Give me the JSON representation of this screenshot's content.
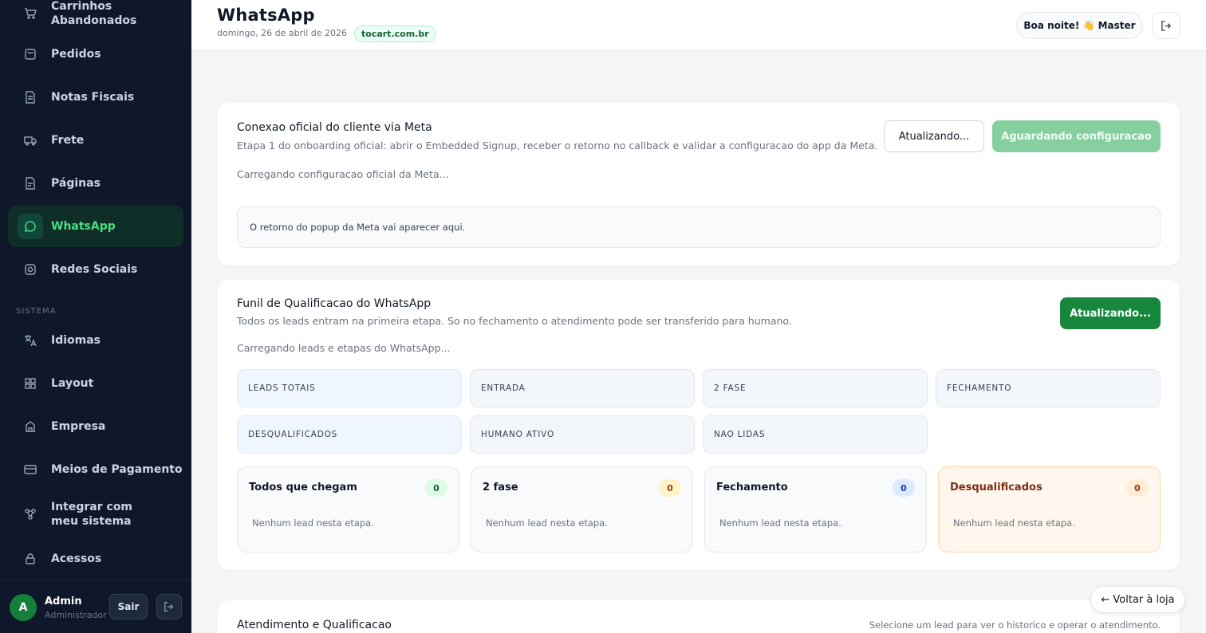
{
  "sidebar": {
    "items": [
      {
        "label": "Carrinhos Abandonados",
        "icon": "cart-icon"
      },
      {
        "label": "Pedidos",
        "icon": "bag-icon"
      },
      {
        "label": "Notas Fiscais",
        "icon": "document-icon"
      },
      {
        "label": "Frete",
        "icon": "truck-icon"
      },
      {
        "label": "Páginas",
        "icon": "page-icon"
      },
      {
        "label": "WhatsApp",
        "icon": "chat-icon"
      },
      {
        "label": "Redes Sociais",
        "icon": "instagram-icon"
      },
      {
        "label": "Idiomas",
        "icon": "translate-icon"
      },
      {
        "label": "Layout",
        "icon": "layout-icon"
      },
      {
        "label": "Empresa",
        "icon": "building-icon"
      },
      {
        "label": "Meios de Pagamento",
        "icon": "credit-card-icon"
      },
      {
        "label": "Integrar com meu sistema",
        "icon": "integration-icon"
      },
      {
        "label": "Acessos",
        "icon": "lock-icon"
      }
    ],
    "section_label": "SISTEMA",
    "active_item": "WhatsApp",
    "user": {
      "initial": "A",
      "name": "Admin",
      "role": "Administrador",
      "logout_label": "Sair"
    }
  },
  "header": {
    "title": "WhatsApp",
    "date": "domingo, 26 de abril de 2026",
    "domain": "tocart.com.br",
    "greeting": "Boa noite! 👋 Master"
  },
  "meta_card": {
    "title": "Conexao oficial do cliente via Meta",
    "subtitle": "Etapa 1 do onboarding oficial: abrir o Embedded Signup, receber o retorno no callback e validar a configuracao do app da Meta.",
    "refresh_label": "Atualizando...",
    "waiting_label": "Aguardando configuracao",
    "loading_text": "Carregando configuracao oficial da Meta...",
    "popup_text": "O retorno do popup da Meta vai aparecer aqui."
  },
  "funnel_card": {
    "title": "Funil de Qualificacao do WhatsApp",
    "subtitle": "Todos os leads entram na primeira etapa. So no fechamento o atendimento pode ser transferido para humano.",
    "refresh_label": "Atualizando...",
    "loading_text": "Carregando leads e etapas do WhatsApp...",
    "stats": [
      "LEADS TOTAIS",
      "ENTRADA",
      "2 FASE",
      "FECHAMENTO",
      "DESQUALIFICADOS",
      "HUMANO ATIVO",
      "NAO LIDAS"
    ],
    "stages": [
      {
        "title": "Todos que chegam",
        "count": "0",
        "empty": "Nenhum lead nesta etapa."
      },
      {
        "title": "2 fase",
        "count": "0",
        "empty": "Nenhum lead nesta etapa."
      },
      {
        "title": "Fechamento",
        "count": "0",
        "empty": "Nenhum lead nesta etapa."
      },
      {
        "title": "Desqualificados",
        "count": "0",
        "empty": "Nenhum lead nesta etapa."
      }
    ]
  },
  "attend_card": {
    "title": "Atendimento e Qualificacao",
    "hint": "Selecione um lead para ver o historico e operar o atendimento."
  },
  "floating": {
    "back_label": "← Voltar à loja"
  },
  "colors": {
    "sidebar_bg": "#0f172a",
    "accent_green": "#16873d",
    "active_text": "#4ade80"
  }
}
